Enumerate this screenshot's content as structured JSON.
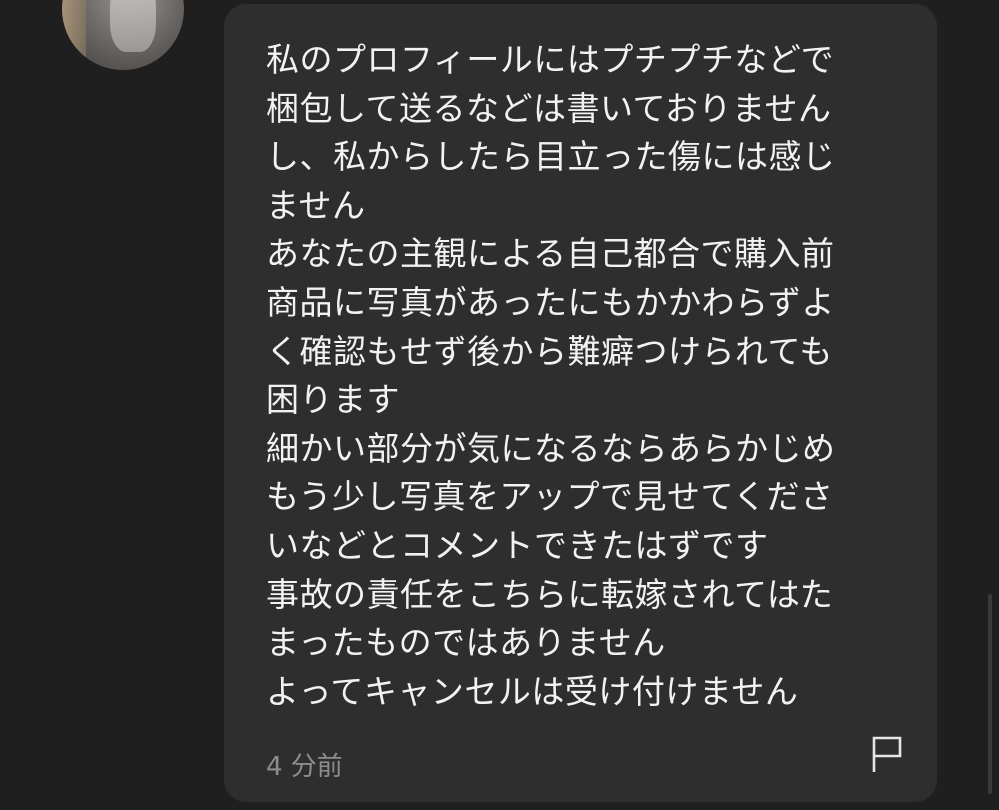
{
  "message": {
    "lines": [
      "私のプロフィールにはプチプチなどで",
      "梱包して送るなどは書いておりません",
      "し、私からしたら目立った傷には感じ",
      "ません",
      "あなたの主観による自己都合で購入前",
      "商品に写真があったにもかかわらずよ",
      "く確認もせず後から難癖つけられても",
      "困ります",
      "細かい部分が気になるならあらかじめ",
      "もう少し写真をアップで見せてくださ",
      "いなどとコメントできたはずです",
      "事故の責任をこちらに転嫁されてはた",
      "まったものではありません",
      "よってキャンセルは受け付けません"
    ],
    "timestamp": "4 分前"
  },
  "icons": {
    "flag": "flag-icon",
    "avatar": "user-avatar"
  },
  "colors": {
    "background": "#1f1f1f",
    "bubble": "#2e2e2e",
    "text": "#f2f2f2",
    "timestamp": "#8d8d8d"
  }
}
